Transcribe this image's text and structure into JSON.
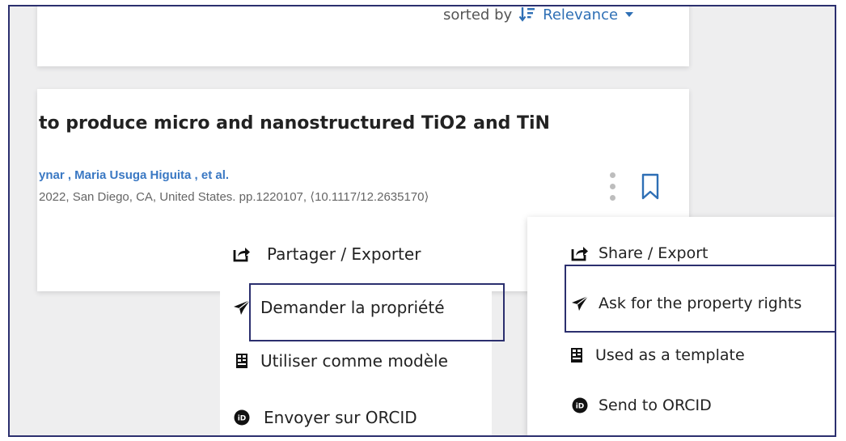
{
  "sort": {
    "prefix": "sorted by",
    "value": "Relevance"
  },
  "result": {
    "title": "to produce micro and nanostructured TiO2 and TiN",
    "authors": "ynar , Maria Usuga Higuita , et al.",
    "citation": "2022, San Diego, CA, United States. pp.1220107, ⟨10.1117/12.2635170⟩"
  },
  "menu_fr": {
    "items": [
      {
        "label": "Partager / Exporter",
        "icon": "share-export-icon"
      },
      {
        "label": "Demander la propriété",
        "icon": "paper-plane-icon"
      },
      {
        "label": "Utiliser comme modèle",
        "icon": "template-icon"
      },
      {
        "label": "Envoyer sur ORCID",
        "icon": "orcid-icon"
      }
    ]
  },
  "menu_en": {
    "items": [
      {
        "label": "Share / Export",
        "icon": "share-export-icon"
      },
      {
        "label": "Ask for the property rights",
        "icon": "paper-plane-icon"
      },
      {
        "label": "Used as a template",
        "icon": "template-icon"
      },
      {
        "label": "Send to ORCID",
        "icon": "orcid-icon"
      }
    ]
  },
  "colors": {
    "accent_blue": "#2e6fb5",
    "author_blue": "#3a78c3",
    "highlight_border": "#2b2f6e",
    "background": "#eeeeef"
  }
}
